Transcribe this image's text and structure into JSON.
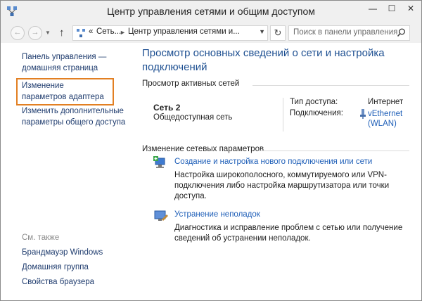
{
  "window": {
    "title": "Центр управления сетями и общим доступом",
    "minimize": "—",
    "maximize": "☐",
    "close": "✕"
  },
  "address": {
    "back_icon": "back-arrow-icon",
    "forward_icon": "forward-arrow-icon",
    "up_icon": "up-arrow-icon",
    "prefix": "«",
    "crumbs": [
      "Сеть...",
      "Центр управления сетями и..."
    ],
    "refresh_icon": "refresh-icon",
    "search_placeholder": "Поиск в панели управления"
  },
  "sidebar": {
    "home_link": "Панель управления — домашняя страница",
    "adapter_link": "Изменение параметров адаптера",
    "sharing_link": "Изменить дополнительные параметры общего доступа",
    "see_also": "См. также",
    "see_also_links": [
      "Брандмауэр Windows",
      "Домашняя группа",
      "Свойства браузера"
    ],
    "highlight_color": "#e27f22"
  },
  "main": {
    "title": "Просмотр основных сведений о сети и настройка подключений",
    "active_header": "Просмотр активных сетей",
    "network_name": "Сеть  2",
    "network_type": "Общедоступная сеть",
    "access_label": "Тип доступа:",
    "access_value": "Интернет",
    "connections_label": "Подключения:",
    "connection_value": "vEthernet (WLAN)",
    "change_header": "Изменение сетевых параметров",
    "tasks": [
      {
        "link": "Создание и настройка нового подключения или сети",
        "desc": "Настройка широкополосного, коммутируемого или VPN-подключения либо настройка маршрутизатора или точки доступа."
      },
      {
        "link": "Устранение неполадок",
        "desc": "Диагностика и исправление проблем с сетью или получение сведений об устранении неполадок."
      }
    ],
    "link_color": "#1f5fb8",
    "title_color": "#1d4f91"
  }
}
